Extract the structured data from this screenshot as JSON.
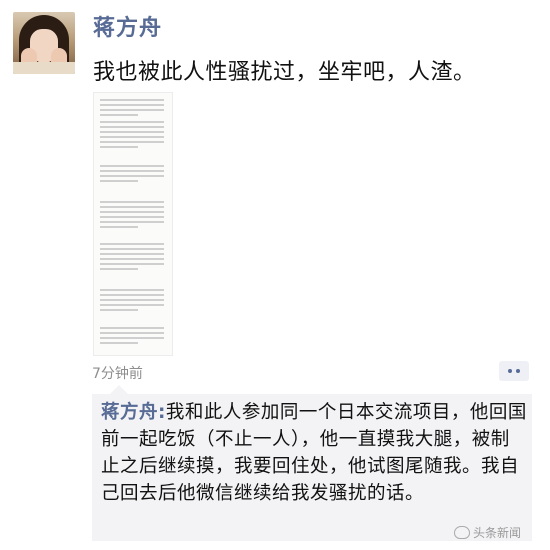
{
  "post": {
    "author": "蒋方舟",
    "text": "我也被此人性骚扰过，坐牢吧，人渣。",
    "time": "7分钟前"
  },
  "comment": {
    "author": "蒋方舟",
    "separator": ":",
    "text": "我和此人参加同一个日本交流项目，他回国前一起吃饭（不止一人），他一直摸我大腿，被制止之后继续摸，我要回住处，他试图尾随我。我自己回去后他微信继续给我发骚扰的话。"
  },
  "watermark": {
    "text": "头条新闻"
  },
  "icons": {
    "avatar": "avatar",
    "more": "more-dots-icon",
    "watermark": "weibo-icon"
  },
  "colors": {
    "accent": "#576b95",
    "comment_bg": "#f3f3f5",
    "time": "#8e8e8e"
  }
}
